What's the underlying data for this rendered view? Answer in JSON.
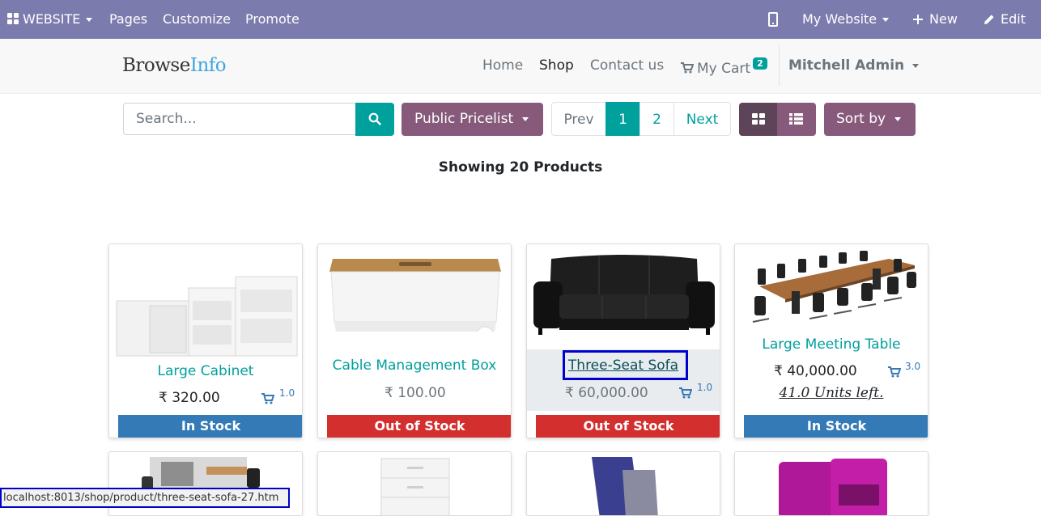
{
  "admin_bar": {
    "website_menu": "WEBSITE",
    "pages": "Pages",
    "customize": "Customize",
    "promote": "Promote",
    "my_website": "My Website",
    "new": "New",
    "edit": "Edit"
  },
  "header": {
    "logo_part1": "Browse",
    "logo_part2": "Info",
    "nav": [
      "Home",
      "Shop",
      "Contact us"
    ],
    "cart_label": "My Cart",
    "cart_count": "2",
    "user": "Mitchell Admin"
  },
  "toolbar": {
    "search_placeholder": "Search...",
    "pricelist": "Public Pricelist",
    "pager": {
      "prev": "Prev",
      "pages": [
        "1",
        "2"
      ],
      "next": "Next",
      "current": "1"
    },
    "sort": "Sort by"
  },
  "showing_text": "Showing 20 Products",
  "products": [
    {
      "name": "Large Cabinet",
      "price": "₹ 320.00",
      "qty": "1.0",
      "stock": "In Stock"
    },
    {
      "name": "Cable Management Box",
      "price": "₹ 100.00",
      "stock": "Out of Stock"
    },
    {
      "name": "Three-Seat Sofa",
      "price": "₹ 60,000.00",
      "qty": "1.0",
      "stock": "Out of Stock"
    },
    {
      "name": "Large Meeting Table",
      "price": "₹ 40,000.00",
      "qty": "3.0",
      "units_left": "41.0 Units left.",
      "stock": "In Stock"
    }
  ],
  "status_url": "localhost:8013/shop/product/three-seat-sofa-27.htm",
  "colors": {
    "admin_bar": "#7c7bad",
    "primary": "#00a09d",
    "secondary": "#875a7b",
    "in_stock": "#337ab7",
    "out_of_stock": "#d32f2f",
    "focus_outline": "#0000cc"
  },
  "icons": [
    "grid-icon",
    "mobile-icon",
    "plus-icon",
    "pencil-icon",
    "cart-icon",
    "search-icon",
    "grid-view-icon",
    "list-view-icon"
  ]
}
